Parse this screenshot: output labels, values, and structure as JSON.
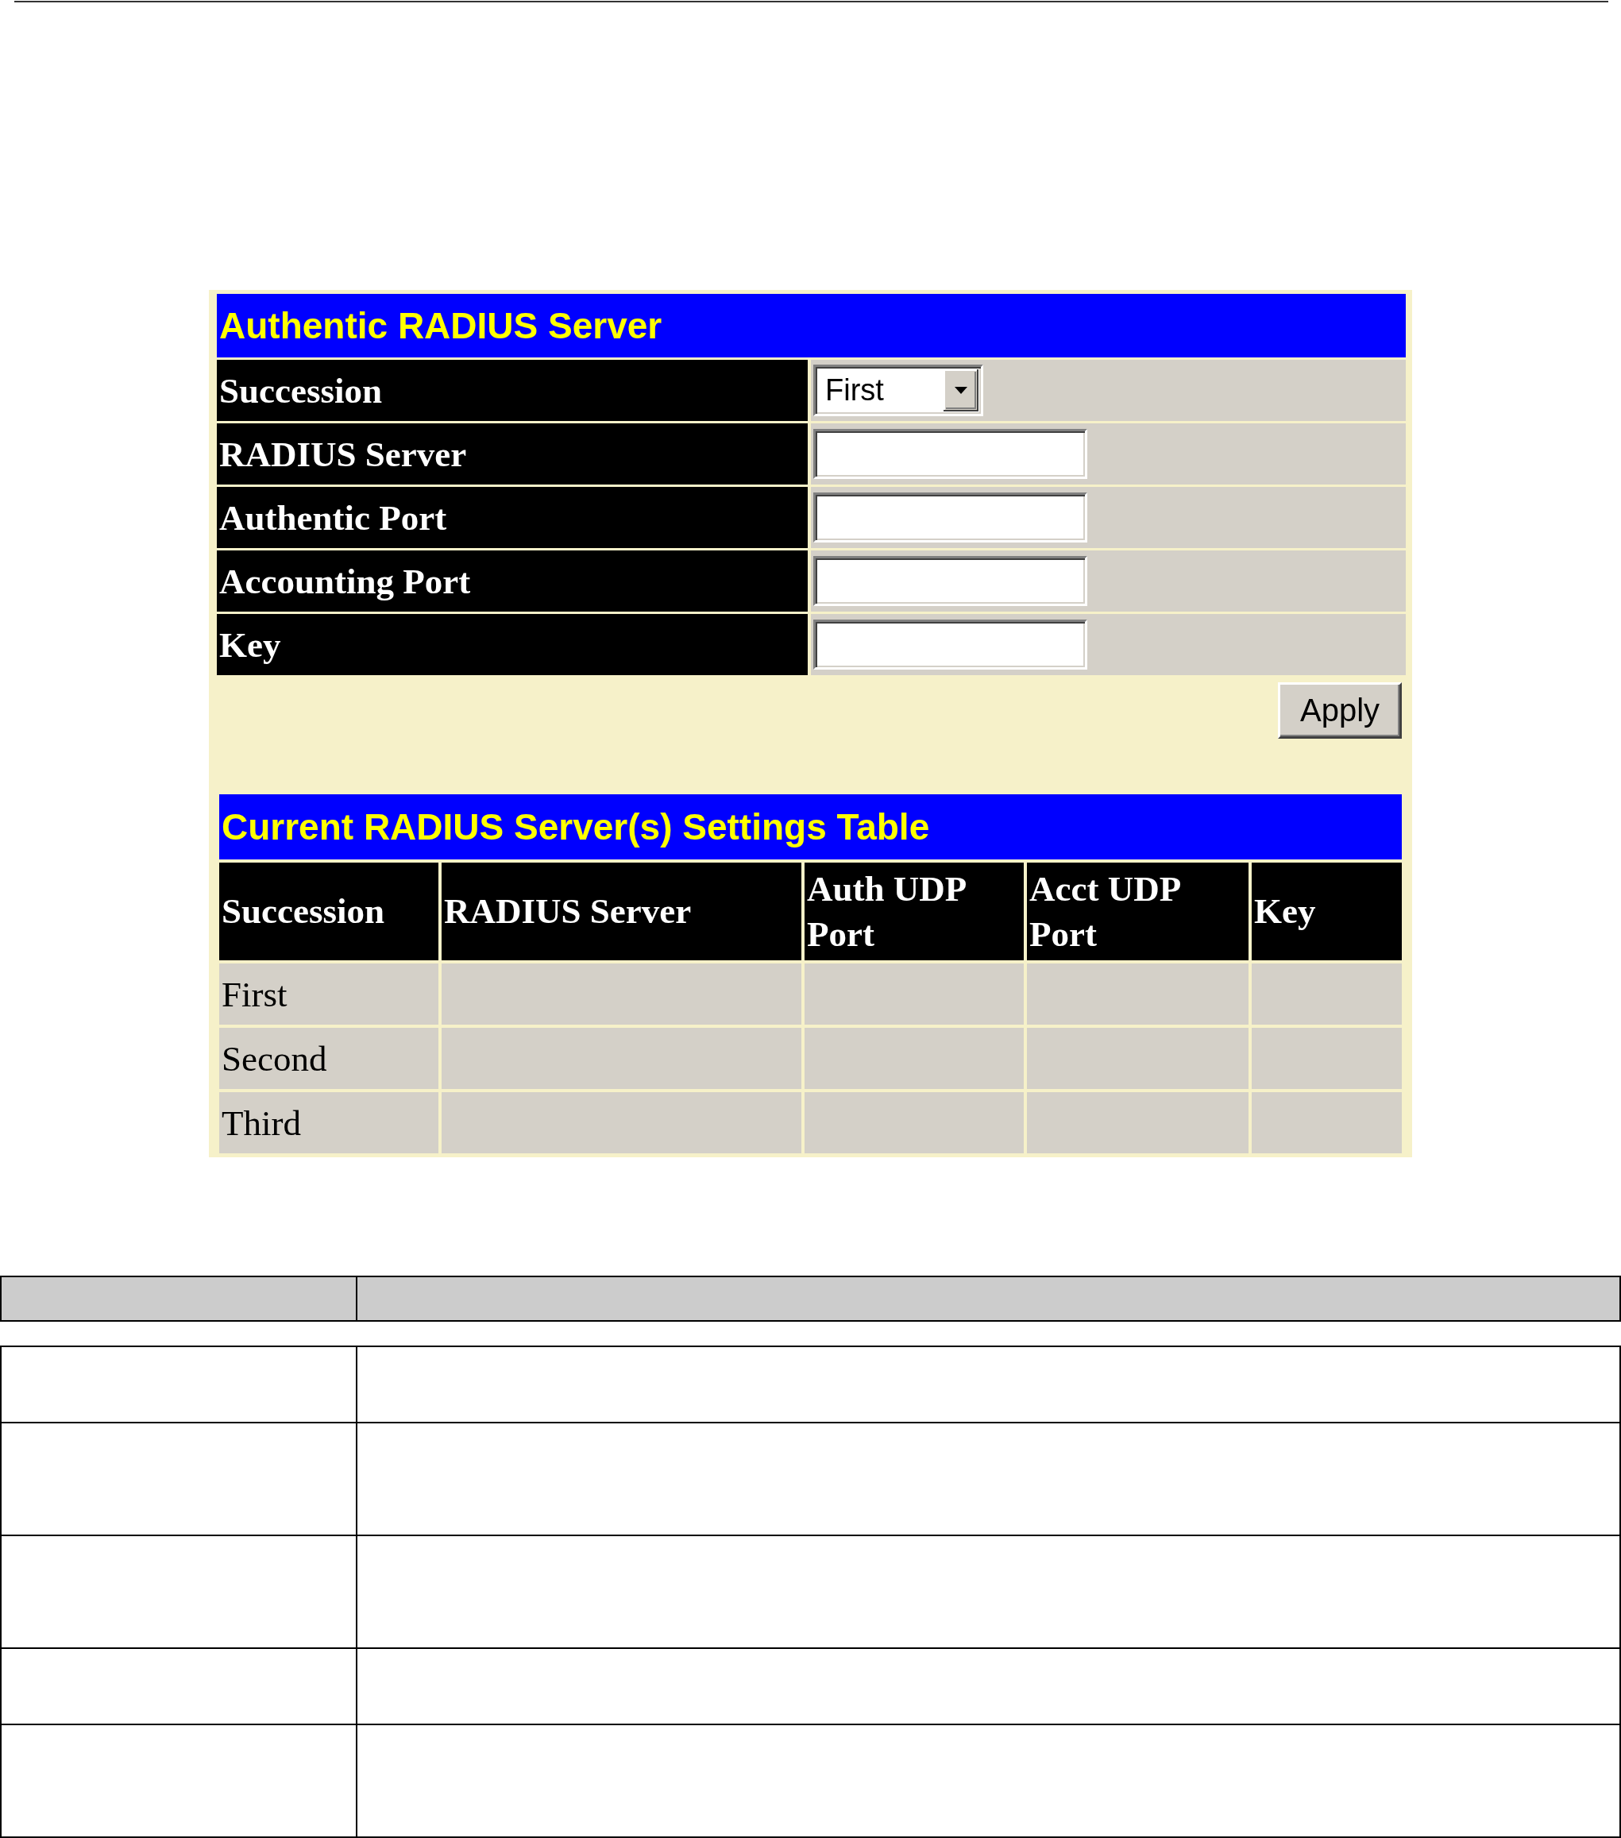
{
  "form": {
    "title": "Authentic RADIUS Server",
    "fields": [
      {
        "label": "Succession",
        "kind": "dropdown",
        "value": "First"
      },
      {
        "label": "RADIUS Server",
        "kind": "text"
      },
      {
        "label": "Authentic Port",
        "kind": "text"
      },
      {
        "label": "Accounting Port",
        "kind": "text"
      },
      {
        "label": "Key",
        "kind": "text"
      }
    ],
    "apply_button": "Apply"
  },
  "settings_table": {
    "title": "Current RADIUS Server(s) Settings Table",
    "columns": [
      "Succession",
      "RADIUS Server",
      "Auth UDP Port",
      "Acct UDP Port",
      "Key"
    ],
    "rows": [
      {
        "succession": "First"
      },
      {
        "succession": "Second"
      },
      {
        "succession": "Third"
      }
    ]
  },
  "description_table": {
    "rows": [
      {
        "kind": "short"
      },
      {
        "kind": "tall"
      },
      {
        "kind": "tall"
      },
      {
        "kind": "short"
      },
      {
        "kind": "tall"
      }
    ]
  }
}
